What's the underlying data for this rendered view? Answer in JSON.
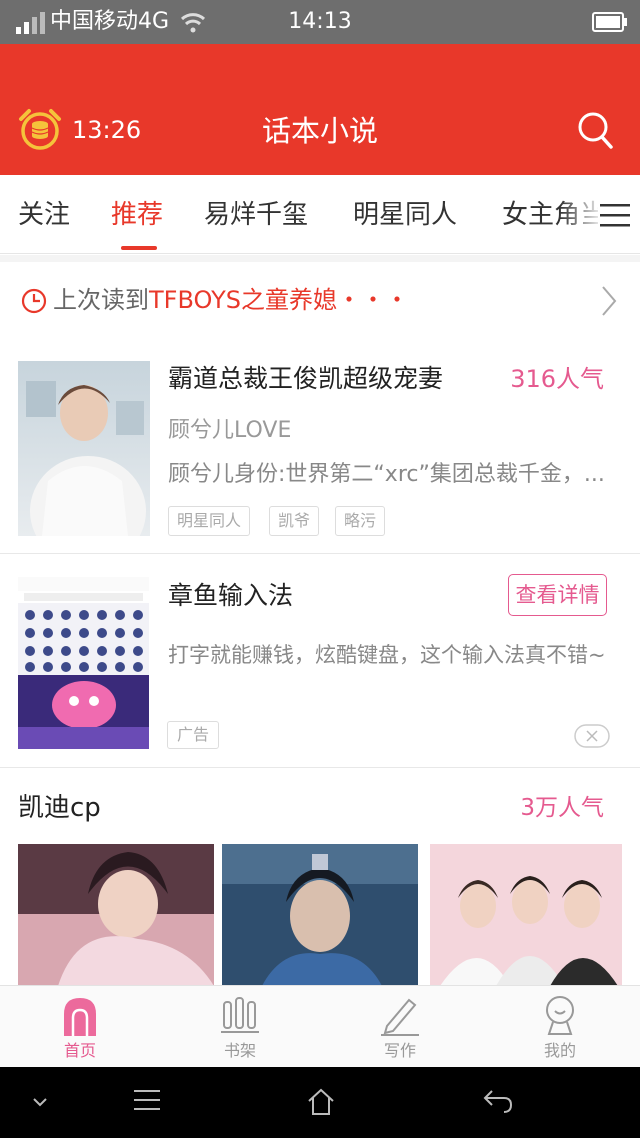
{
  "status_bar": {
    "carrier": "中国移动4G",
    "time": "14:13"
  },
  "header": {
    "reading_time": "13:26",
    "title": "话本小说"
  },
  "tabs": [
    {
      "label": "关注"
    },
    {
      "label": "推荐",
      "active": true
    },
    {
      "label": "易烊千玺"
    },
    {
      "label": "明星同人"
    },
    {
      "label": "女主角当"
    }
  ],
  "last_read": {
    "prefix": "上次读到",
    "book": "TFBOYS之童养媳・・・"
  },
  "book": {
    "title": "霸道总裁王俊凯超级宠妻",
    "popularity": "316人气",
    "author": "顾兮儿LOVE",
    "description": "顾兮儿身份:世界第二“xrc”集团总裁千金，...",
    "tags": [
      "明星同人",
      "凯爷",
      "略污"
    ]
  },
  "ad": {
    "title": "章鱼输入法",
    "button": "查看详情",
    "description": "打字就能赚钱，炫酷键盘，这个输入法真不错~",
    "badge": "广告"
  },
  "section": {
    "title": "凯迪cp",
    "popularity": "3万人气"
  },
  "bottom_nav": [
    {
      "label": "首页",
      "icon": "home-icon",
      "active": true
    },
    {
      "label": "书架",
      "icon": "bookshelf-icon"
    },
    {
      "label": "写作",
      "icon": "pen-icon"
    },
    {
      "label": "我的",
      "icon": "profile-icon"
    }
  ],
  "colors": {
    "brand_red": "#e8382a",
    "accent_pink": "#e55a8f"
  }
}
